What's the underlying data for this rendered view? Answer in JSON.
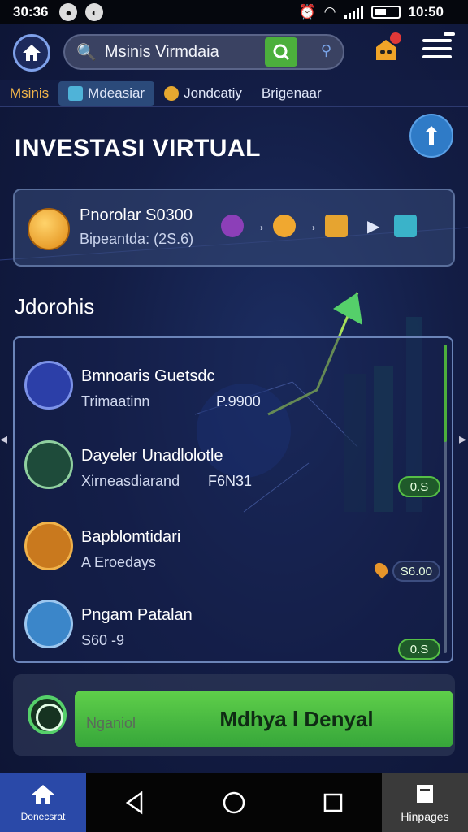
{
  "status_bar": {
    "time_left": "30:36",
    "time_right": "10:50"
  },
  "header": {
    "search_value": "Msinis Virmdaia"
  },
  "tabs": [
    {
      "label": "Msinis"
    },
    {
      "label": "Mdeasiar"
    },
    {
      "label": "Jondcatiy"
    },
    {
      "label": "Brigenaar"
    }
  ],
  "page_title": "INVESTASI VIRTUAL",
  "portfolio": {
    "title": "Pnorolar S0300",
    "subtitle": "Bipeantda: (2S.6)"
  },
  "section_title": "Jdorohis",
  "list": [
    {
      "name": "Bmnoaris Guetsdc",
      "sub": "Trimaatinn",
      "amount": "P.9900",
      "chip": ""
    },
    {
      "name": "Dayeler Unadlolotle",
      "sub": "Xirneasdiarand",
      "amount": "F6N31",
      "chip": "0.S"
    },
    {
      "name": "Bapblomtidari",
      "sub": "A Eroedays",
      "amount": "",
      "chip": "S6.00"
    },
    {
      "name": "Pngam Patalan",
      "sub": "S60 -9",
      "amount": "",
      "chip": "0.S"
    }
  ],
  "action": {
    "label": "Nganiol",
    "button": "Mdhya l Denyal"
  },
  "navbar": {
    "home_label": "Donecsrat",
    "pages_label": "Hinpages"
  },
  "colors": {
    "accent_green": "#4caf3c",
    "nav_blue": "#2a49a8",
    "tab_orange": "#f0b44a"
  }
}
